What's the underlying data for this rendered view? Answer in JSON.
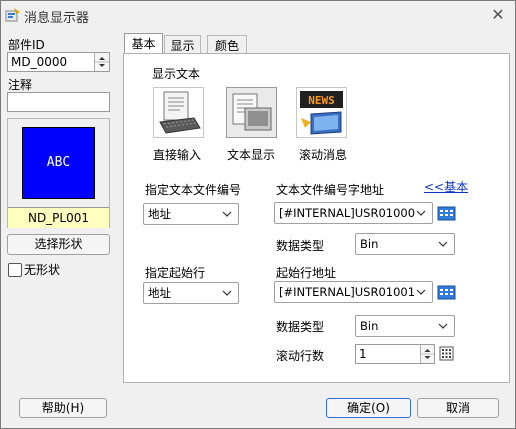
{
  "window": {
    "title": "消息显示器"
  },
  "left": {
    "part_id_label": "部件ID",
    "part_id_value": "MD_0000",
    "comment_label": "注释",
    "comment_value": "",
    "preview_text": "ABC",
    "preview_name": "ND_PL001",
    "select_shape_button": "选择形状",
    "no_shape_label": "无形状"
  },
  "tabs": [
    "基本",
    "显示",
    "颜色"
  ],
  "panel": {
    "display_text_label": "显示文本",
    "modes": [
      "直接输入",
      "文本显示",
      "滚动消息"
    ],
    "text_file_number_label": "指定文本文件编号",
    "text_file_number_value": "地址",
    "text_file_address_label": "文本文件编号字地址",
    "back_link": "<<基本",
    "text_file_address_value": "[#INTERNAL]USR01000",
    "data_type_label_1": "数据类型",
    "data_type_value_1": "Bin",
    "start_line_label": "指定起始行",
    "start_line_value": "地址",
    "start_line_address_label": "起始行地址",
    "start_line_address_value": "[#INTERNAL]USR01001",
    "data_type_label_2": "数据类型",
    "data_type_value_2": "Bin",
    "scroll_lines_label": "滚动行数",
    "scroll_lines_value": "1"
  },
  "footer": {
    "help": "帮助(H)",
    "ok": "确定(O)",
    "cancel": "取消"
  },
  "colors": {
    "preview_bg": "#0000ff",
    "name_bar_bg": "#ffffc0",
    "link": "#0f35c8"
  }
}
